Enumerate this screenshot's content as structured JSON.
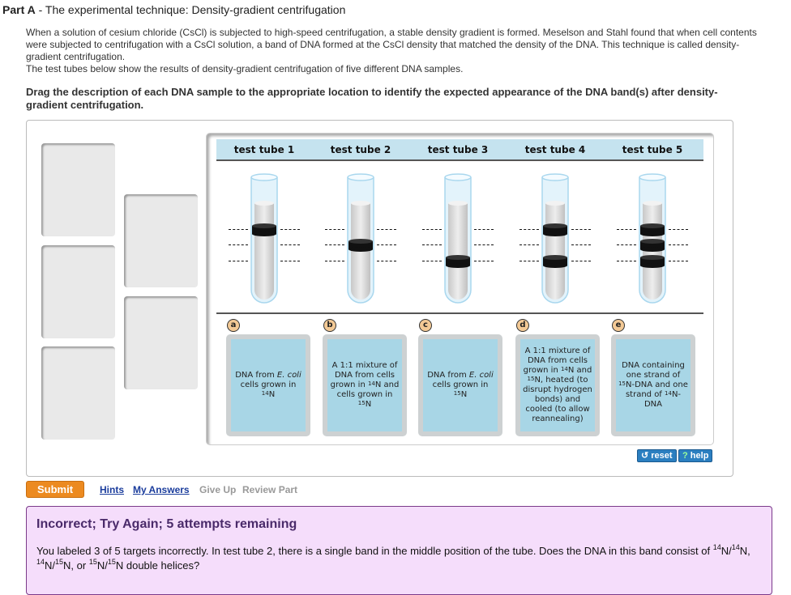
{
  "header": {
    "part": "Part A",
    "sep": " - ",
    "title": "The experimental technique: Density-gradient centrifugation"
  },
  "intro": [
    "When a solution of cesium chloride (CsCl) is subjected to high-speed centrifugation, a stable density gradient is formed. Meselson and Stahl found that when cell contents were subjected to centrifugation with a CsCl solution, a band of DNA formed at the CsCl density that matched the density of the DNA. This technique is called density-gradient centrifugation.",
    "The test tubes below show the results of density-gradient centrifugation of five different DNA samples."
  ],
  "instruction": "Drag the description of each DNA sample to the appropriate location to identify the expected appearance of the DNA band(s) after density-gradient centrifugation.",
  "tubes": [
    {
      "label": "test tube 1",
      "bands": [
        "top"
      ]
    },
    {
      "label": "test tube 2",
      "bands": [
        "middle"
      ]
    },
    {
      "label": "test tube 3",
      "bands": [
        "bottom"
      ]
    },
    {
      "label": "test tube 4",
      "bands": [
        "top",
        "bottom"
      ]
    },
    {
      "label": "test tube 5",
      "bands": [
        "top",
        "middle",
        "bottom"
      ]
    }
  ],
  "cards": [
    {
      "letter": "a",
      "segments": [
        {
          "t": "DNA from "
        },
        {
          "t": "E. coli",
          "s": "i"
        },
        {
          "t": " cells grown in "
        },
        {
          "t": "14",
          "s": "sup"
        },
        {
          "t": "N"
        }
      ]
    },
    {
      "letter": "b",
      "segments": [
        {
          "t": "A 1:1 mixture of DNA from cells grown in "
        },
        {
          "t": "14",
          "s": "sup"
        },
        {
          "t": "N and cells grown in "
        },
        {
          "t": "15",
          "s": "sup"
        },
        {
          "t": "N"
        }
      ]
    },
    {
      "letter": "c",
      "segments": [
        {
          "t": "DNA from "
        },
        {
          "t": "E. coli",
          "s": "i"
        },
        {
          "t": " cells grown in "
        },
        {
          "t": "15",
          "s": "sup"
        },
        {
          "t": "N"
        }
      ]
    },
    {
      "letter": "d",
      "segments": [
        {
          "t": "A 1:1 mixture of DNA from cells grown in "
        },
        {
          "t": "14",
          "s": "sup"
        },
        {
          "t": "N and "
        },
        {
          "t": "15",
          "s": "sup"
        },
        {
          "t": "N, heated (to disrupt hydrogen bonds) and cooled (to allow reannealing)"
        }
      ]
    },
    {
      "letter": "e",
      "segments": [
        {
          "t": "DNA containing one strand of "
        },
        {
          "t": "15",
          "s": "sup"
        },
        {
          "t": "N-DNA and one strand of "
        },
        {
          "t": "14",
          "s": "sup"
        },
        {
          "t": "N-DNA"
        }
      ]
    }
  ],
  "controls": {
    "reset": "reset",
    "help": "help",
    "reset_icon": "undo-icon",
    "help_icon": "question-icon"
  },
  "actions": {
    "submit": "Submit",
    "hints": "Hints",
    "my_answers": "My Answers",
    "give_up": "Give Up",
    "review_part": "Review Part"
  },
  "feedback": {
    "title": "Incorrect; Try Again; 5 attempts remaining",
    "segments": [
      {
        "t": "You labeled 3 of 5 targets incorrectly. In test tube 2, there is a single band in the middle position of the tube. Does the DNA in this band consist of "
      },
      {
        "t": "14",
        "s": "sup"
      },
      {
        "t": "N/"
      },
      {
        "t": "14",
        "s": "sup"
      },
      {
        "t": "N, "
      },
      {
        "t": "14",
        "s": "sup"
      },
      {
        "t": "N/"
      },
      {
        "t": "15",
        "s": "sup"
      },
      {
        "t": "N, or "
      },
      {
        "t": "15",
        "s": "sup"
      },
      {
        "t": "N/"
      },
      {
        "t": "15",
        "s": "sup"
      },
      {
        "t": "N double helices?"
      }
    ]
  },
  "colors": {
    "accent": "#ec8a20",
    "header_strip": "#c5e3ef",
    "card": "#a8d6e6",
    "feedback_bg": "#f5ddfb"
  }
}
